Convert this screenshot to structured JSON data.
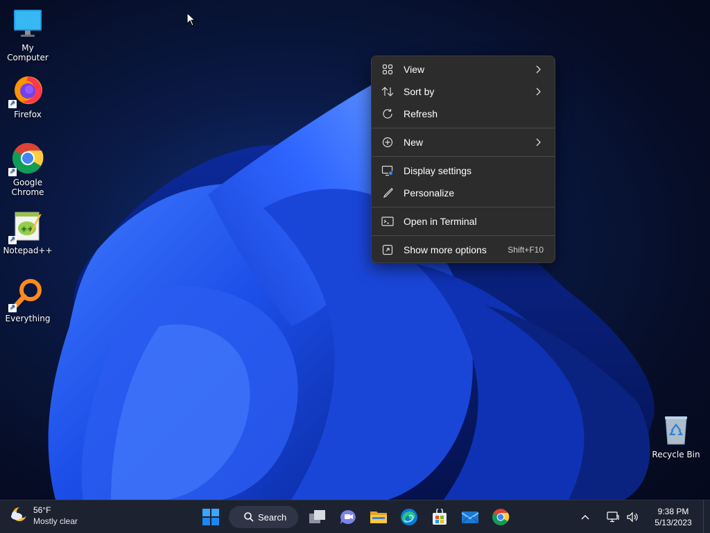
{
  "desktop": {
    "icons": [
      {
        "label": "My Computer",
        "icon": "monitor-icon"
      },
      {
        "label": "Firefox",
        "icon": "firefox-icon"
      },
      {
        "label": "Google Chrome",
        "icon": "chrome-icon"
      },
      {
        "label": "Notepad++",
        "icon": "notepad-plus-plus-icon"
      },
      {
        "label": "Everything",
        "icon": "everything-search-icon"
      },
      {
        "label": "Recycle Bin",
        "icon": "recycle-bin-icon"
      }
    ]
  },
  "context_menu": {
    "items": [
      {
        "label": "View",
        "icon": "grid-icon",
        "submenu": true
      },
      {
        "label": "Sort by",
        "icon": "sort-icon",
        "submenu": true
      },
      {
        "label": "Refresh",
        "icon": "refresh-icon",
        "submenu": false
      },
      {
        "label": "New",
        "icon": "plus-circle-icon",
        "submenu": true
      },
      {
        "label": "Display settings",
        "icon": "display-icon",
        "submenu": false
      },
      {
        "label": "Personalize",
        "icon": "brush-icon",
        "submenu": false
      },
      {
        "label": "Open in Terminal",
        "icon": "terminal-icon",
        "submenu": false
      },
      {
        "label": "Show more options",
        "icon": "expand-icon",
        "shortcut": "Shift+F10"
      }
    ]
  },
  "taskbar": {
    "weather": {
      "temp": "56°F",
      "condition": "Mostly clear",
      "icon": "moon-cloud-icon"
    },
    "search_label": "Search",
    "apps": [
      "start-icon",
      "task-view-icon",
      "teams-chat-icon",
      "file-explorer-icon",
      "edge-icon",
      "store-icon",
      "mail-icon",
      "chrome-icon"
    ],
    "clock": {
      "time": "9:38 PM",
      "date": "5/13/2023"
    }
  },
  "colors": {
    "menu_bg": "#2c2c2c",
    "taskbar_bg": "#1d2230",
    "accent": "#3b7bff"
  }
}
